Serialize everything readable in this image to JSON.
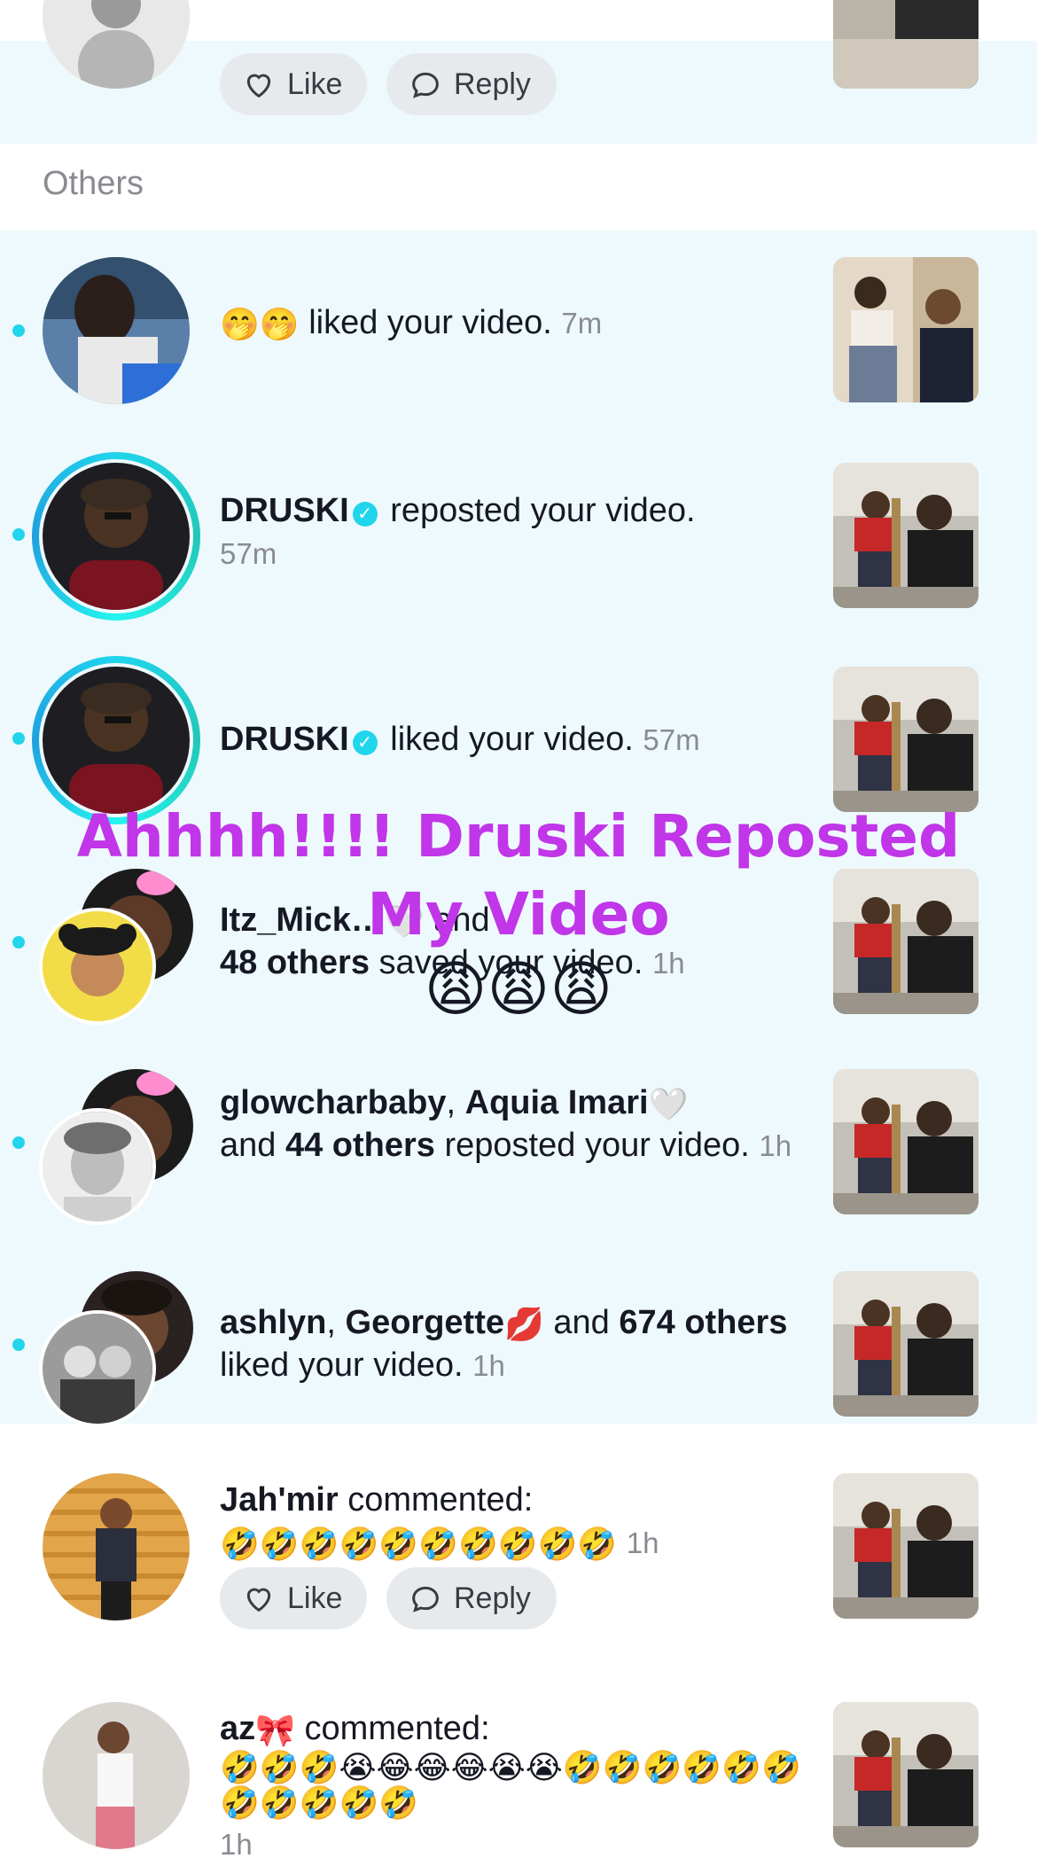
{
  "section": {
    "others_label": "Others"
  },
  "actions": {
    "like_label": "Like",
    "reply_label": "Reply"
  },
  "notifications": [
    {
      "type": "like",
      "user_emojis": "🤭🤭",
      "action": "liked your video.",
      "time": "7m"
    },
    {
      "type": "repost",
      "user": "DRUSKI",
      "verified": true,
      "action": "reposted your video.",
      "time": "57m"
    },
    {
      "type": "like",
      "user": "DRUSKI",
      "verified": true,
      "action": "liked your video.",
      "time": "57m"
    },
    {
      "type": "save",
      "user": "Itz_Mick…",
      "suffix": "🤍",
      "joiner": "and",
      "others": "48 others",
      "action": "saved your video.",
      "time": "1h"
    },
    {
      "type": "repost",
      "user1": "glowcharbaby",
      "sep": ",",
      "user2": "Aquia Imari",
      "user2_emoji": "🤍",
      "joiner": "and",
      "others": "44 others",
      "action": "reposted your video.",
      "time": "1h"
    },
    {
      "type": "like",
      "user1": "ashlyn",
      "sep": ",",
      "user2": "Georgette",
      "user2_emoji": "💋",
      "joiner": "and",
      "others": "674 others",
      "action": "liked your video.",
      "time": "1h"
    },
    {
      "type": "comment",
      "user": "Jah'mir",
      "action": "commented:",
      "comment": "🤣🤣🤣🤣🤣🤣🤣🤣🤣🤣",
      "time": "1h"
    },
    {
      "type": "comment",
      "user": "az",
      "user_emoji": "🎀",
      "action": "commented:",
      "comment": "🤣🤣🤣😭😂😂😂😭😭🤣🤣🤣🤣🤣🤣🤣🤣🤣🤣🤣",
      "time": "1h"
    }
  ],
  "overlay": {
    "line1": "Ahhhh!!!! Druski Reposted",
    "line2": "My Video",
    "emojis": "😩😩😩",
    "color": "#c036e8"
  },
  "colors": {
    "accent": "#20d5ec",
    "unread_bg": "#eef9fd"
  }
}
